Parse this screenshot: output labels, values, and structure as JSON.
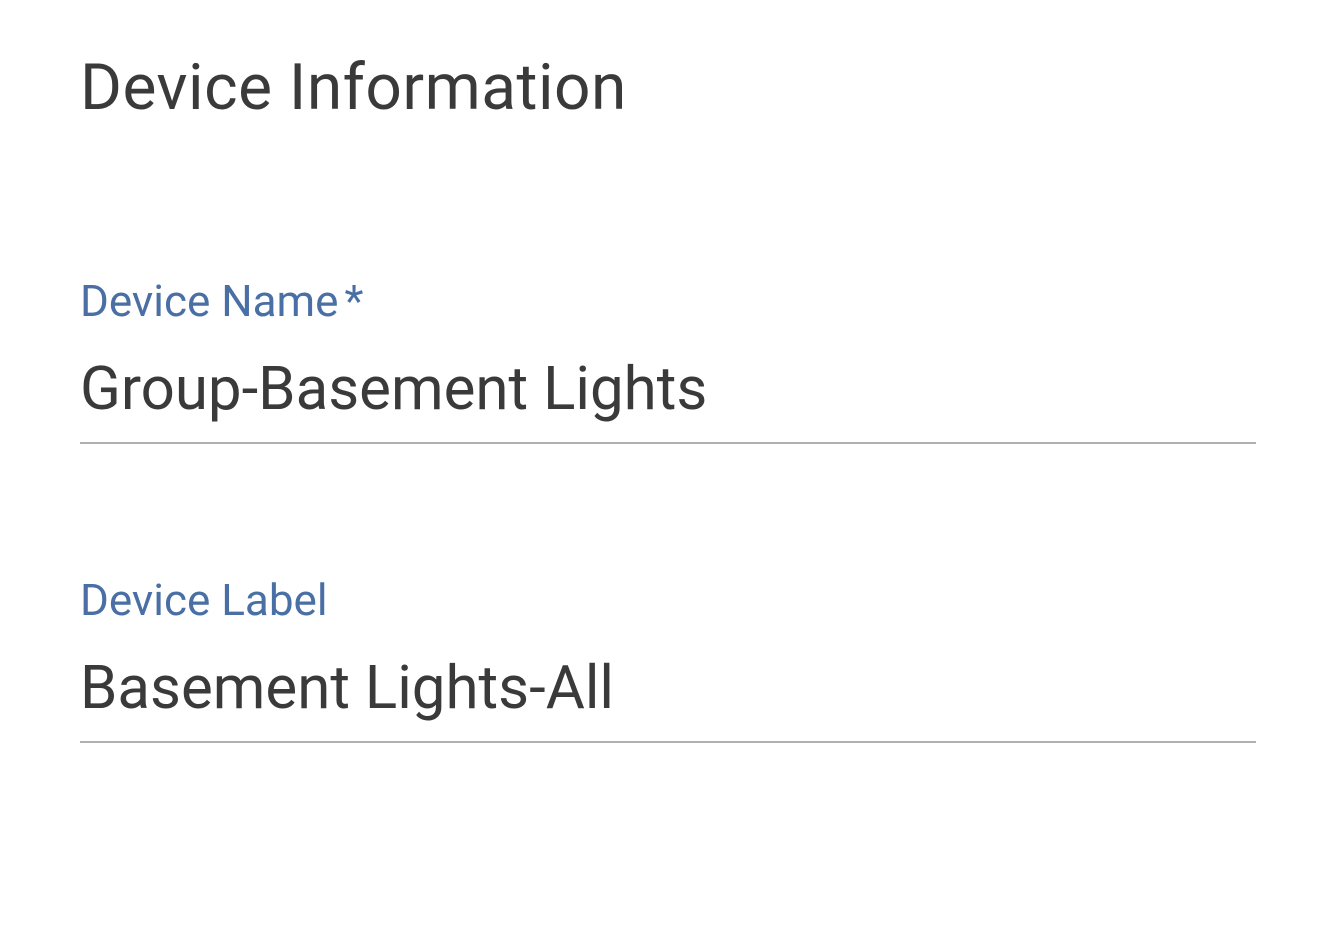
{
  "section": {
    "title": "Device Information"
  },
  "fields": {
    "device_name": {
      "label": "Device Name",
      "required_marker": "*",
      "value": "Group-Basement Lights"
    },
    "device_label": {
      "label": "Device Label",
      "value": "Basement Lights-All"
    }
  }
}
